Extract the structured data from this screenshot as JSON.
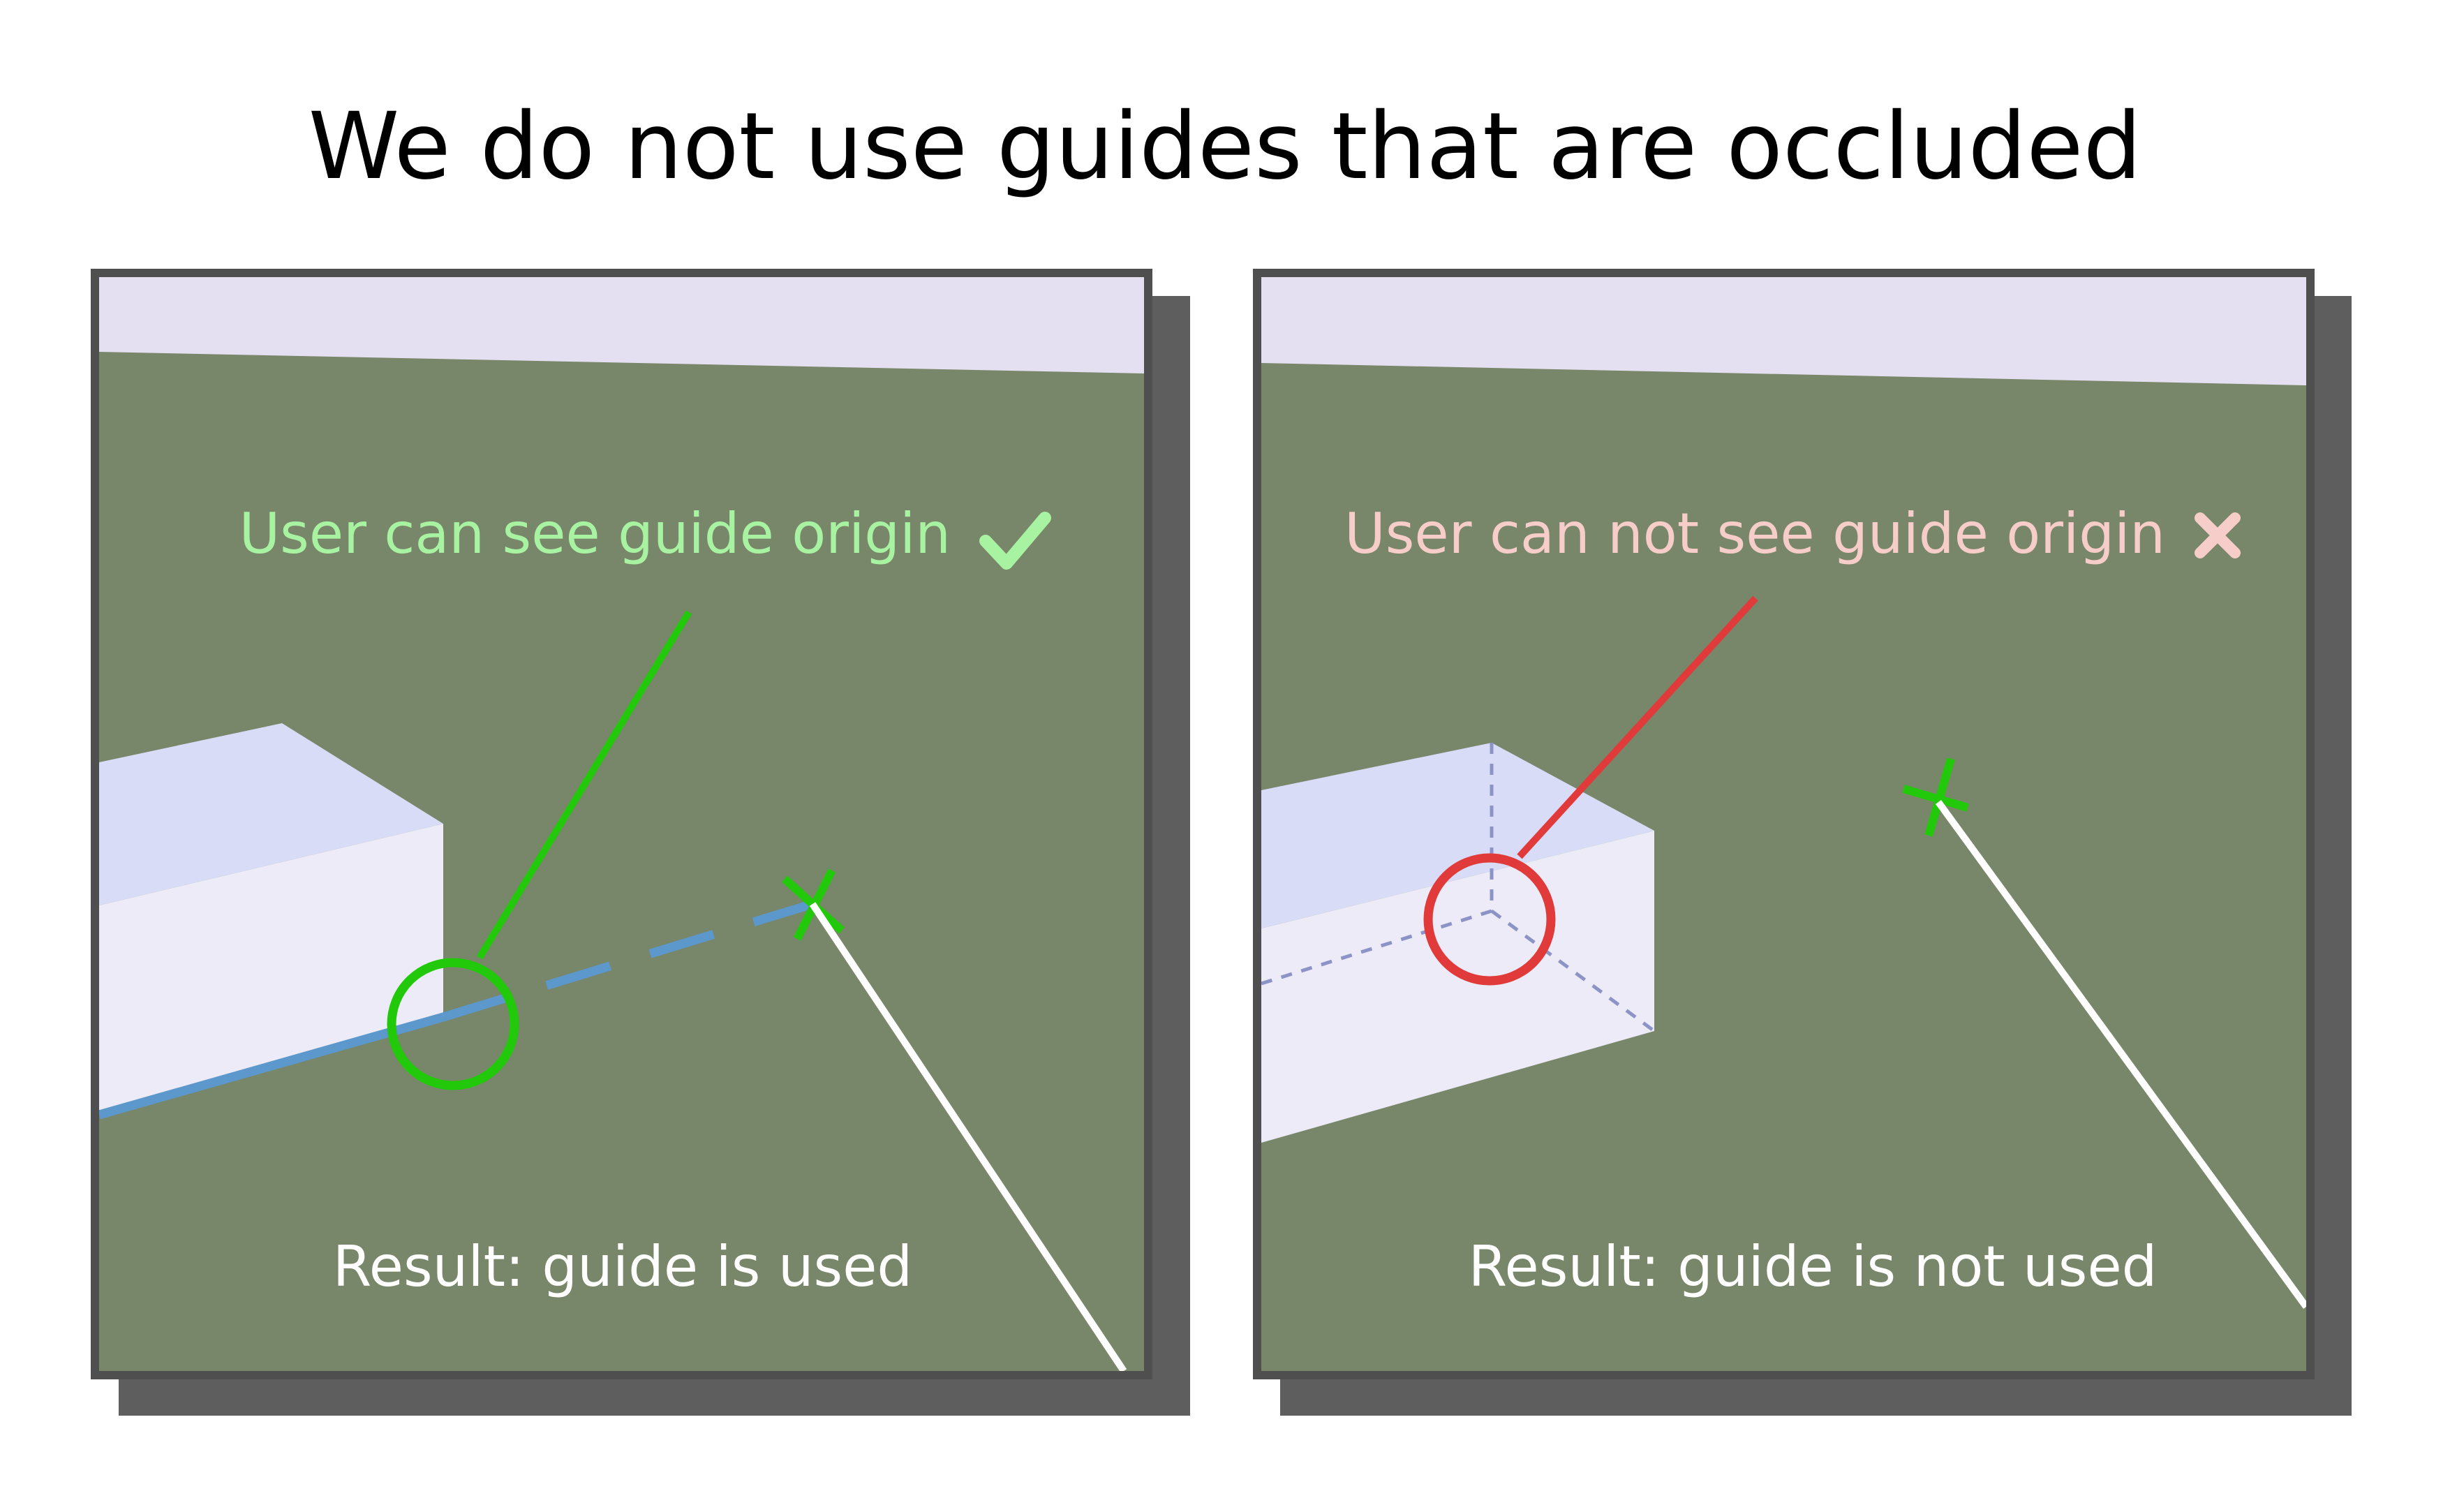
{
  "title": "We do not use guides that are occluded",
  "colors": {
    "ground": "#788669",
    "sky": "#e4e0f1",
    "box_top": "#d8dcf7",
    "box_side": "#ecebf7",
    "frame": "#4f4f4f",
    "shadow": "#5e5e5e",
    "visible_origin": "#22c90b",
    "hidden_origin": "#e03a3a",
    "guide_line": "#5c98cb",
    "hidden_edge": "#8c93c6",
    "positive_caption": "#a8f3a1",
    "negative_caption": "#f6cdc8",
    "result_text": "#ffffff",
    "pointer_line": "#ffffff"
  },
  "panels": [
    {
      "caption": "User can see guide origin",
      "status_icon": "check-icon",
      "origin_marker": "green-circle-icon",
      "target_marker": "green-cross-icon",
      "result": "Result: guide is used"
    },
    {
      "caption": "User can not see guide origin",
      "status_icon": "cross-icon",
      "origin_marker": "red-circle-icon",
      "target_marker": "green-cross-icon",
      "result": "Result: guide is not used"
    }
  ]
}
